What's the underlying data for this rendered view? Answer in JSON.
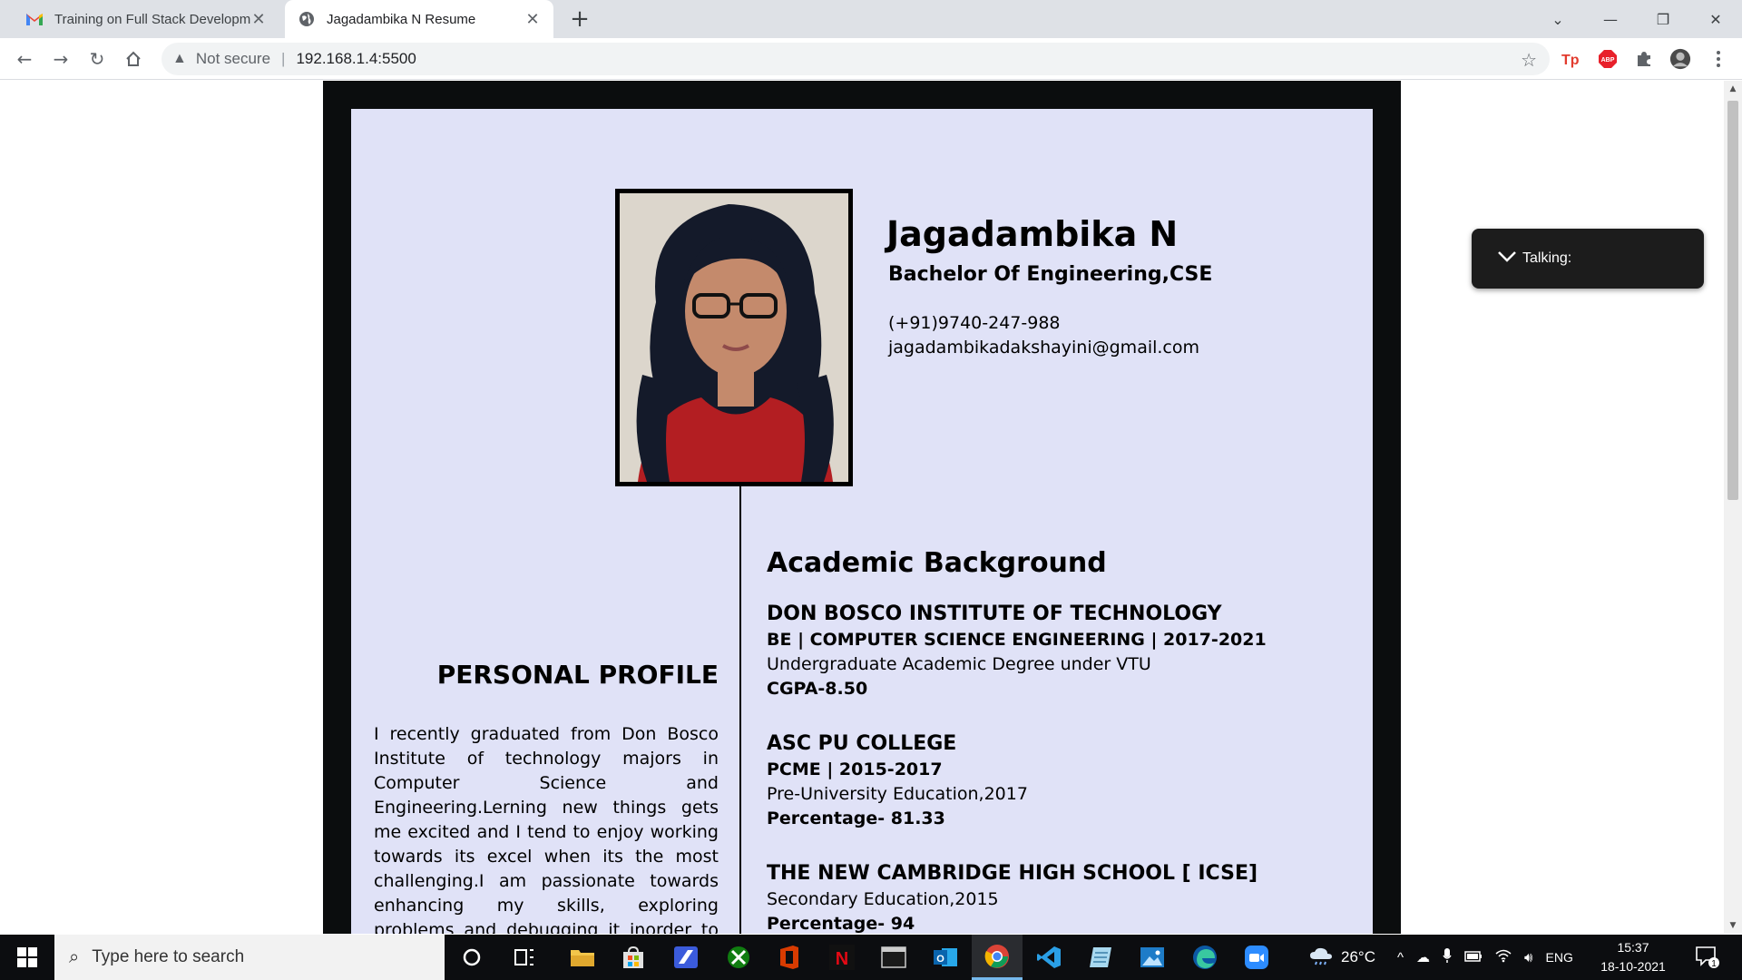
{
  "browser": {
    "tabs": [
      {
        "title": "Training on Full Stack Developme",
        "icon": "gmail-icon"
      },
      {
        "title": "Jagadambika N Resume",
        "icon": "globe-icon"
      }
    ],
    "new_tab": "+",
    "security_label": "Not secure",
    "url": "192.168.1.4:5500"
  },
  "overlay": {
    "label": "Talking:"
  },
  "resume": {
    "name": "Jagadambika N",
    "degree": "Bachelor Of Engineering,CSE",
    "phone": "(+91)9740-247-988",
    "email": "jagadambikadakshayini@gmail.com",
    "profile_title": "PERSONAL PROFILE",
    "profile_text": "I recently graduated from Don Bosco Institute of technology majors in Computer Science and Engineering.Lerning new things gets me excited and I tend to enjoy working towards its excel when its the most challenging.I am passionate towards enhancing my skills, exploring problems and debugging it inorder to gain more",
    "academic_title": "Academic Background",
    "education": [
      {
        "institution": "DON BOSCO INSTITUTE OF TECHNOLOGY",
        "course": "BE | COMPUTER SCIENCE ENGINEERING | 2017-2021",
        "description": "Undergraduate Academic Degree under VTU",
        "score": "CGPA-8.50"
      },
      {
        "institution": "ASC PU COLLEGE",
        "course": "PCME | 2015-2017",
        "description": "Pre-University Education,2017",
        "score": "Percentage- 81.33"
      },
      {
        "institution": "THE NEW CAMBRIDGE HIGH SCHOOL [ ICSE]",
        "description": "Secondary Education,2015",
        "score": "Percentage- 94"
      }
    ]
  },
  "taskbar": {
    "search_placeholder": "Type here to search",
    "weather": "26°C",
    "language": "ENG",
    "time": "15:37",
    "date": "18-10-2021",
    "notification_count": "1"
  }
}
